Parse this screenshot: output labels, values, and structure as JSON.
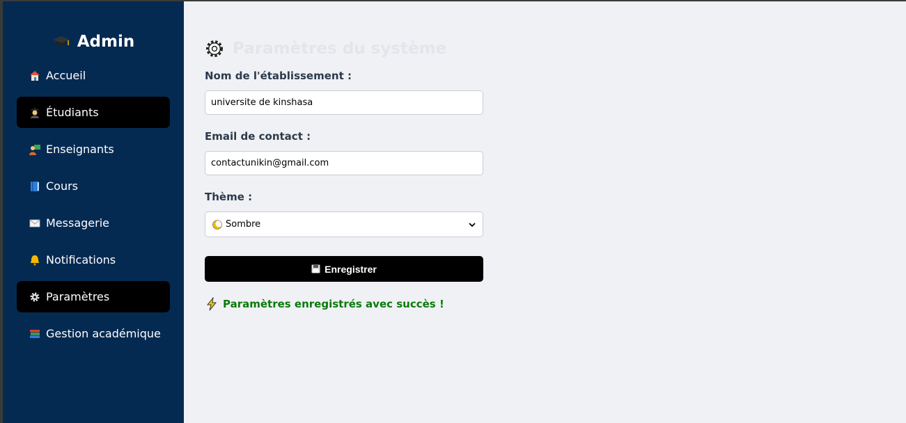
{
  "sidebar": {
    "brand": {
      "icon": "graduation-cap-icon",
      "title": "Admin"
    },
    "items": [
      {
        "label": "Accueil",
        "icon": "house-icon",
        "active": false
      },
      {
        "label": "Étudiants",
        "icon": "student-icon",
        "active": true
      },
      {
        "label": "Enseignants",
        "icon": "teacher-icon",
        "active": false
      },
      {
        "label": "Cours",
        "icon": "book-icon",
        "active": false
      },
      {
        "label": "Messagerie",
        "icon": "envelope-icon",
        "active": false
      },
      {
        "label": "Notifications",
        "icon": "bell-icon",
        "active": false
      },
      {
        "label": "Paramètres",
        "icon": "gear-icon",
        "active": true
      },
      {
        "label": "Gestion académique",
        "icon": "books-icon",
        "active": false
      }
    ]
  },
  "main": {
    "title": "Paramètres du système",
    "form": {
      "name_label": "Nom de l'établissement :",
      "name_value": "universite de kinshasa",
      "email_label": "Email de contact :",
      "email_value": "contactunikin@gmail.com",
      "theme_label": "Thème :",
      "theme_value": "Sombre",
      "save_label": "Enregistrer"
    },
    "success_message": "Paramètres enregistrés avec succès !"
  },
  "colors": {
    "sidebar_bg": "#052a52",
    "active_item_bg": "#000000",
    "main_bg": "#f0f1f5",
    "success": "#0a7a0a"
  }
}
